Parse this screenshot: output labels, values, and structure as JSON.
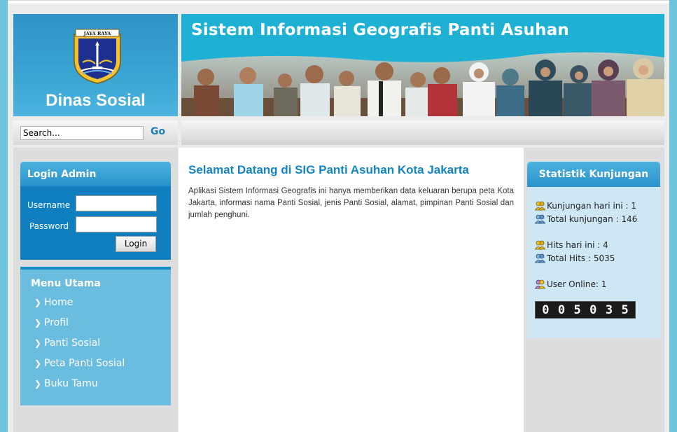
{
  "header": {
    "logo_title": "Dinas Sosial",
    "emblem_ribbon": "JAYA RAYA",
    "banner_title": "Sistem Informasi Geografis Panti Asuhan"
  },
  "search": {
    "value": "Search...",
    "go_label": "Go"
  },
  "login": {
    "title": "Login Admin",
    "username_label": "Username",
    "password_label": "Password",
    "username_value": "",
    "password_value": "",
    "button_label": "Login"
  },
  "menu": {
    "title": "Menu Utama",
    "items": [
      {
        "label": "Home"
      },
      {
        "label": "Profil"
      },
      {
        "label": "Panti Sosial"
      },
      {
        "label": "Peta Panti Sosial"
      },
      {
        "label": "Buku Tamu"
      }
    ]
  },
  "content": {
    "title": "Selamat Datang di SIG Panti Asuhan Kota Jakarta",
    "body": "Aplikasi Sistem Informasi Geografis ini hanya memberikan data keluaran berupa peta Kota Jakarta, informasi nama Panti Sosial, jenis Panti Sosial, alamat, pimpinan Panti Sosial dan jumlah penghuni."
  },
  "stats": {
    "title": "Statistik Kunjungan",
    "visits_today": "Kunjungan hari ini : 1",
    "visits_total": "Total kunjungan : 146",
    "hits_today": "Hits hari ini : 4",
    "hits_total": "Total Hits : 5035",
    "users_online": "User Online: 1",
    "counter_digits": [
      "0",
      "0",
      "5",
      "0",
      "3",
      "5"
    ]
  },
  "colors": {
    "brand_blue": "#1fb1d3",
    "header_blue": "#2a92cc",
    "title_blue": "#1285c2",
    "menu_blue": "#6bbde0",
    "stats_bg": "#cde8f4"
  },
  "icons": {
    "user_group_yellow": "users-yellow-icon",
    "user_group_blue": "users-blue-icon",
    "user_group_purple": "users-purple-icon"
  }
}
